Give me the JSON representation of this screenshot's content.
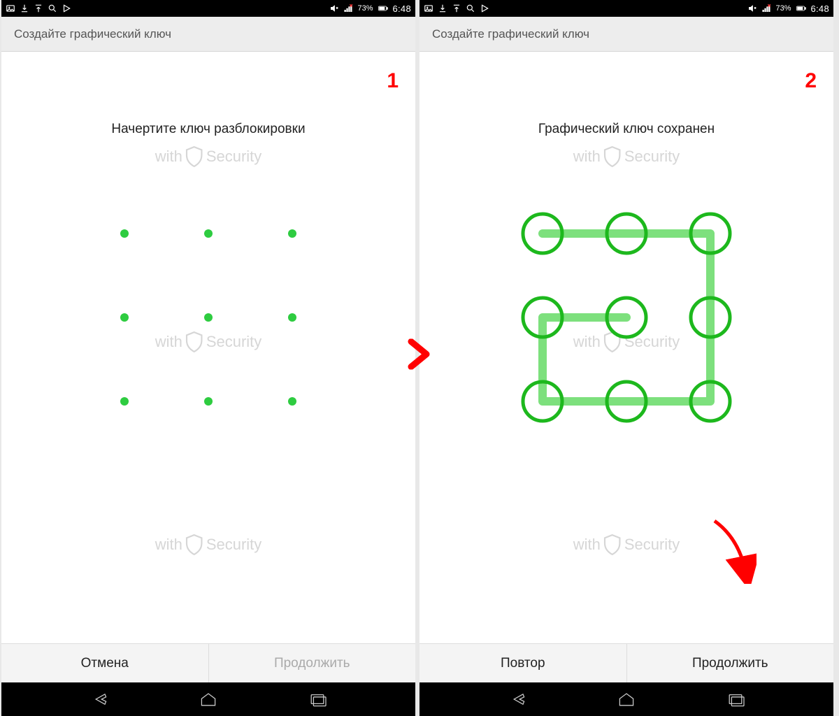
{
  "statusbar": {
    "battery_pct": "73%",
    "time": "6:48"
  },
  "title": "Создайте графический ключ",
  "watermark": {
    "prefix": "with",
    "brand": "Security"
  },
  "screens": [
    {
      "step": "1",
      "instruction": "Начертите ключ разблокировки",
      "pattern_drawn": false,
      "buttons": [
        {
          "label": "Отмена",
          "enabled": true
        },
        {
          "label": "Продолжить",
          "enabled": false
        }
      ]
    },
    {
      "step": "2",
      "instruction": "Графический ключ сохранен",
      "pattern_drawn": true,
      "pattern_sequence": [
        1,
        2,
        3,
        6,
        9,
        8,
        7,
        4,
        5
      ],
      "buttons": [
        {
          "label": "Повтор",
          "enabled": true
        },
        {
          "label": "Продолжить",
          "enabled": true
        }
      ]
    }
  ],
  "colors": {
    "accent_green": "#1db81d",
    "line_green": "#7de07d",
    "step_red": "#ff0000"
  }
}
